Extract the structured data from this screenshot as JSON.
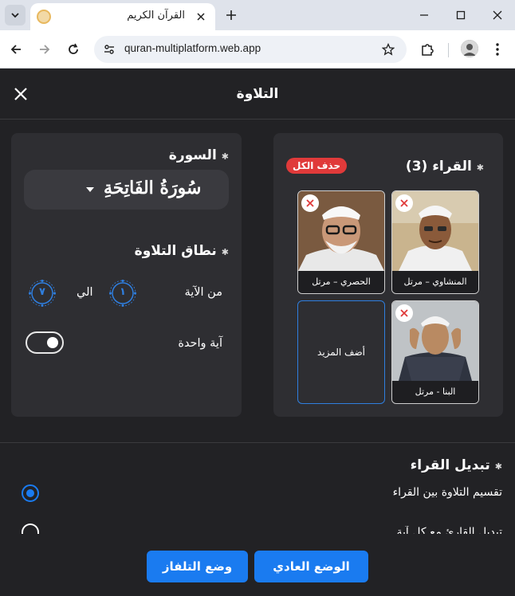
{
  "browser": {
    "tab_title": "القرآن الكريم",
    "url": "quran-multiplatform.web.app"
  },
  "app": {
    "title": "التلاوة",
    "surah_section": {
      "label": "السورة",
      "selected_surah": "سُورَةُ الفَاتِحَةِ"
    },
    "range_section": {
      "label": "نطاق التلاوة",
      "from_label": "من الآية",
      "to_label": "الي",
      "from_ayah": "١",
      "to_ayah": "٧",
      "single_ayah_label": "آية واحدة",
      "single_ayah_on": true
    },
    "reciters_section": {
      "label": "القراء (3)",
      "delete_all": "حذف الكل",
      "reciters": [
        {
          "name": "المنشاوي – مرتل"
        },
        {
          "name": "الحصري – مرتل"
        },
        {
          "name": "البنا - مرتل"
        }
      ],
      "add_more": "أضف المزيد"
    },
    "switch_section": {
      "label": "تبديل القراء",
      "options": [
        {
          "label": "تقسيم التلاوة بين القراء",
          "selected": true
        },
        {
          "label": "تبديل القارئ مع كل آية",
          "selected": false
        }
      ]
    },
    "buttons": {
      "normal_mode": "الوضع العادي",
      "tv_mode": "وضع التلفاز"
    }
  },
  "colors": {
    "accent": "#1a7bf0",
    "danger": "#e03a3a",
    "background": "#222225",
    "card": "#2e2e32"
  }
}
